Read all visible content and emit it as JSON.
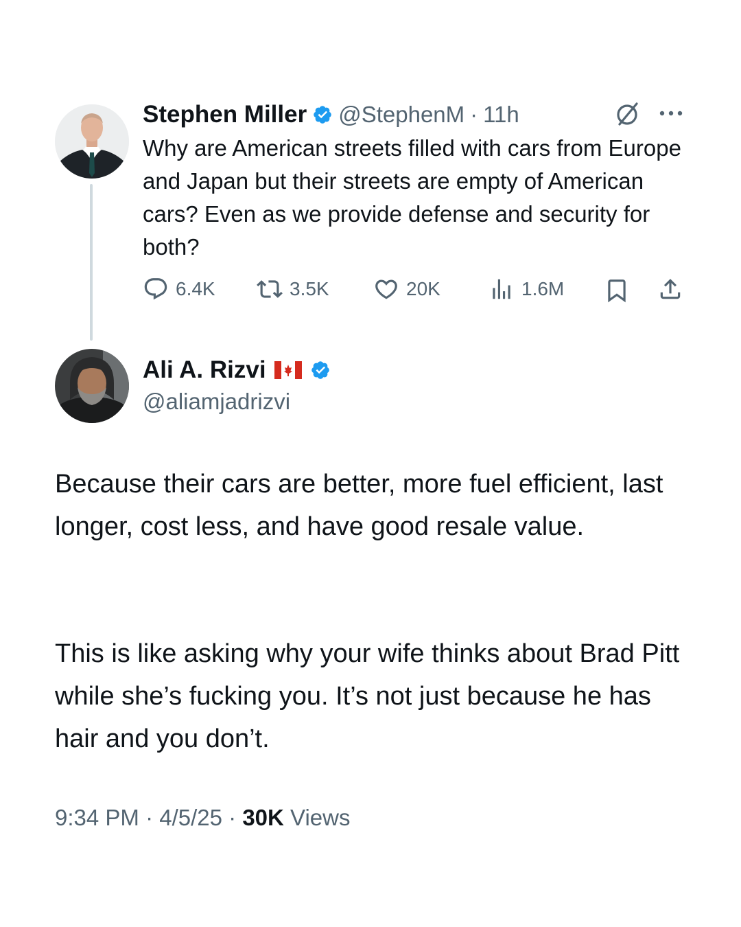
{
  "parent_tweet": {
    "author_name": "Stephen Miller",
    "handle": "@StephenM",
    "separator": "·",
    "time": "11h",
    "text": "Why are American streets filled with cars from Europe and Japan but their streets are empty of American cars? Even as we provide defense and security for both?",
    "stats": {
      "replies": "6.4K",
      "reposts": "3.5K",
      "likes": "20K",
      "views": "1.6M"
    }
  },
  "reply_tweet": {
    "author_name": "Ali A. Rizvi",
    "handle": "@aliamjadrizvi",
    "paragraph_1": "Because their cars are better, more fuel efficient, last longer, cost less, and have good resale value.",
    "paragraph_2": "This is like asking why your wife thinks about Brad Pitt while she’s fucking you. It’s not just because he has hair and you don’t.",
    "timestamp": "9:34 PM · 4/5/25 · ",
    "views_count": "30K",
    "views_label": "Views"
  },
  "colors": {
    "verified_blue": "#1d9bf0",
    "text_primary": "#0f1419",
    "text_secondary": "#536471",
    "thread_line": "#cfd9de",
    "canada_red": "#d52b1e"
  },
  "icons": {
    "grok": "grok-icon",
    "more": "more-icon",
    "reply": "reply-icon",
    "repost": "repost-icon",
    "like": "heart-icon",
    "views": "views-icon",
    "bookmark": "bookmark-icon",
    "share": "share-icon",
    "verified": "verified-badge-icon",
    "flag": "canada-flag-icon"
  }
}
